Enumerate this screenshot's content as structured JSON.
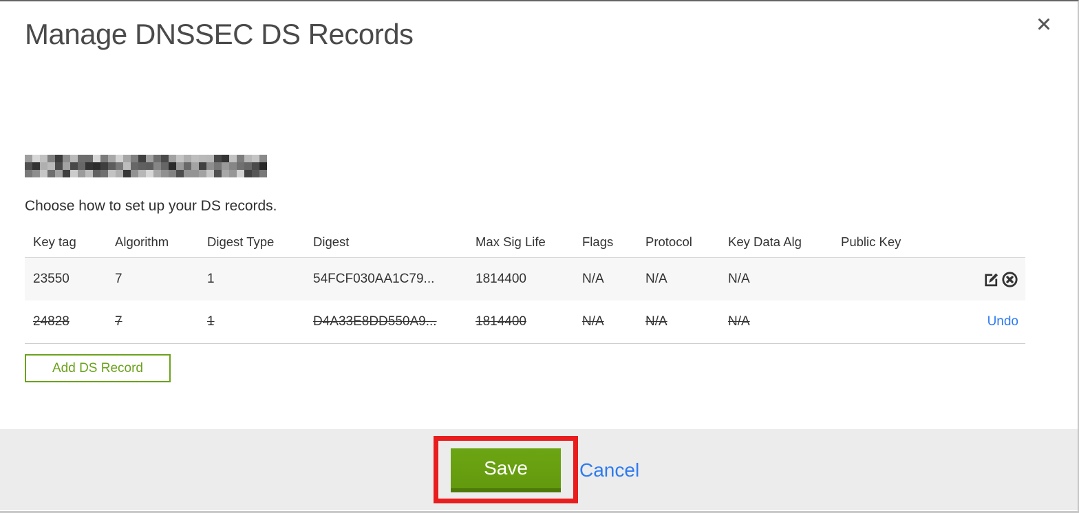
{
  "modal": {
    "title": "Manage DNSSEC DS Records",
    "domain_redacted": true,
    "instruction": "Choose how to set up your DS records.",
    "table": {
      "columns": [
        "Key tag",
        "Algorithm",
        "Digest Type",
        "Digest",
        "Max Sig Life",
        "Flags",
        "Protocol",
        "Key Data Alg",
        "Public Key"
      ],
      "rows": [
        {
          "cells": [
            "23550",
            "7",
            "1",
            "54FCF030AA1C79...",
            "1814400",
            "N/A",
            "N/A",
            "N/A",
            ""
          ],
          "shaded": true,
          "deleted": false,
          "actions": [
            "edit",
            "delete"
          ]
        },
        {
          "cells": [
            "24828",
            "7",
            "1",
            "D4A33E8DD550A9...",
            "1814400",
            "N/A",
            "N/A",
            "N/A",
            ""
          ],
          "shaded": false,
          "deleted": true,
          "actions": [
            "undo"
          ],
          "undo_label": "Undo"
        }
      ]
    },
    "add_button_label": "Add DS Record",
    "footer": {
      "save_label": "Save",
      "cancel_label": "Cancel"
    }
  },
  "icons": {
    "close": "x-cross",
    "edit": "pencil-on-square",
    "delete": "x-in-circle"
  },
  "colors": {
    "accent_green": "#6aa21b",
    "save_green": "#6ca513",
    "save_green_dk1": "#639a0e",
    "save_green_dark": "#4e7a0a",
    "link_blue": "#2e7bf0",
    "annotation_red": "#e91d1d"
  }
}
